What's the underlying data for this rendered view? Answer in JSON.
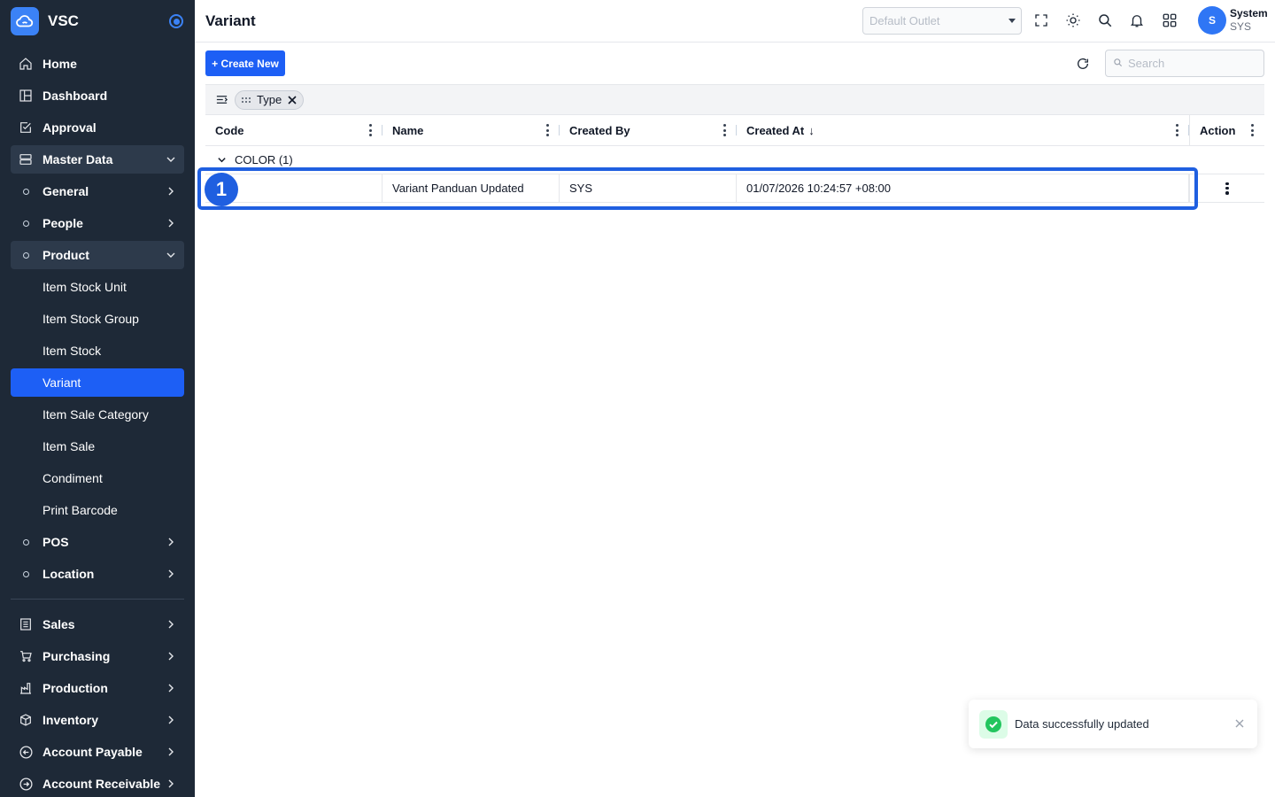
{
  "app": {
    "name": "VSC"
  },
  "sidebar": {
    "items": [
      {
        "label": "Home",
        "icon": "home-icon"
      },
      {
        "label": "Dashboard",
        "icon": "dashboard-icon"
      },
      {
        "label": "Approval",
        "icon": "approval-icon"
      },
      {
        "label": "Master Data",
        "icon": "server-icon"
      },
      {
        "label": "General"
      },
      {
        "label": "People"
      },
      {
        "label": "Product"
      },
      {
        "label": "Item Stock Unit"
      },
      {
        "label": "Item Stock Group"
      },
      {
        "label": "Item Stock"
      },
      {
        "label": "Variant"
      },
      {
        "label": "Item Sale Category"
      },
      {
        "label": "Item Sale"
      },
      {
        "label": "Condiment"
      },
      {
        "label": "Print Barcode"
      },
      {
        "label": "POS"
      },
      {
        "label": "Location"
      },
      {
        "label": "Sales",
        "icon": "sales-icon"
      },
      {
        "label": "Purchasing",
        "icon": "cart-icon"
      },
      {
        "label": "Production",
        "icon": "factory-icon"
      },
      {
        "label": "Inventory",
        "icon": "box-icon"
      },
      {
        "label": "Account Payable",
        "icon": "arrow-left-circle-icon"
      },
      {
        "label": "Account Receivable",
        "icon": "arrow-right-circle-icon"
      }
    ]
  },
  "header": {
    "title": "Variant",
    "outlet_placeholder": "Default Outlet",
    "user": {
      "initial": "S",
      "name": "System",
      "code": "SYS"
    }
  },
  "toolbar": {
    "create_label": "+ Create New",
    "search_placeholder": "Search"
  },
  "grouping": {
    "chip_label": "Type"
  },
  "table": {
    "columns": [
      "Code",
      "Name",
      "Created By",
      "Created At",
      "Action"
    ],
    "sort_indicator": "↓",
    "group_label": "COLOR (1)",
    "rows": [
      {
        "code": "",
        "name": "Variant Panduan Updated",
        "created_by": "SYS",
        "created_at": "01/07/2026 10:24:57 +08:00"
      }
    ]
  },
  "annotation": {
    "step": "1",
    "color": "#1f5fe0"
  },
  "toast": {
    "message": "Data successfully updated"
  },
  "colors": {
    "sidebar_bg": "#1e2937",
    "accent": "#1d5ff5",
    "success": "#22c55e"
  }
}
